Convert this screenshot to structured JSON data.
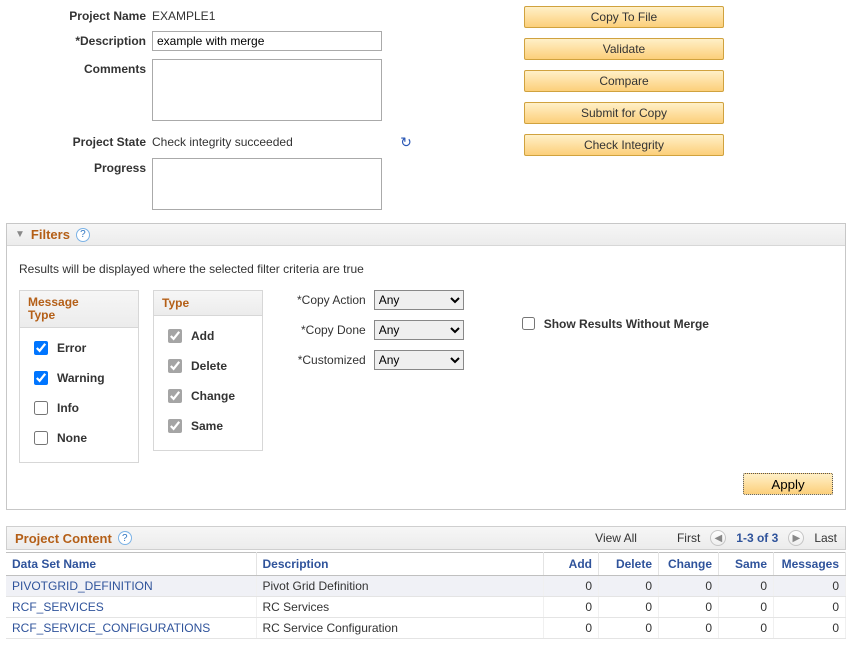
{
  "form": {
    "project_name_label": "Project Name",
    "project_name_value": "EXAMPLE1",
    "description_label": "*Description",
    "description_value": "example with merge",
    "comments_label": "Comments",
    "comments_value": "",
    "project_state_label": "Project State",
    "project_state_value": "Check integrity succeeded",
    "progress_label": "Progress",
    "progress_value": ""
  },
  "actions": {
    "copy_to_file": "Copy To File",
    "validate": "Validate",
    "compare": "Compare",
    "submit_for_copy": "Submit for Copy",
    "check_integrity": "Check Integrity"
  },
  "filters": {
    "section_title": "Filters",
    "hint": "Results will be displayed where the selected filter criteria are true",
    "message_type_title": "Message Type",
    "message_type": {
      "error": {
        "label": "Error",
        "checked": true
      },
      "warning": {
        "label": "Warning",
        "checked": true
      },
      "info": {
        "label": "Info",
        "checked": false
      },
      "none": {
        "label": "None",
        "checked": false
      }
    },
    "type_title": "Type",
    "type": {
      "add": {
        "label": "Add",
        "checked": true
      },
      "delete": {
        "label": "Delete",
        "checked": true
      },
      "change": {
        "label": "Change",
        "checked": true
      },
      "same": {
        "label": "Same",
        "checked": true
      }
    },
    "selects": {
      "copy_action": {
        "label": "*Copy Action",
        "value": "Any"
      },
      "copy_done": {
        "label": "*Copy Done",
        "value": "Any"
      },
      "customized": {
        "label": "*Customized",
        "value": "Any"
      }
    },
    "show_without_merge": {
      "label": "Show Results Without Merge",
      "checked": false
    },
    "apply_label": "Apply"
  },
  "project_content": {
    "section_title": "Project Content",
    "nav": {
      "view_all": "View All",
      "first": "First",
      "range": "1-3 of 3",
      "last": "Last"
    },
    "columns": {
      "data_set": "Data Set Name",
      "description": "Description",
      "add": "Add",
      "delete": "Delete",
      "change": "Change",
      "same": "Same",
      "messages": "Messages"
    },
    "rows": [
      {
        "name": "PIVOTGRID_DEFINITION",
        "desc": "Pivot Grid Definition",
        "add": "0",
        "delete": "0",
        "change": "0",
        "same": "0",
        "messages": "0"
      },
      {
        "name": "RCF_SERVICES",
        "desc": "RC Services",
        "add": "0",
        "delete": "0",
        "change": "0",
        "same": "0",
        "messages": "0"
      },
      {
        "name": "RCF_SERVICE_CONFIGURATIONS",
        "desc": "RC Service Configuration",
        "add": "0",
        "delete": "0",
        "change": "0",
        "same": "0",
        "messages": "0"
      }
    ]
  }
}
